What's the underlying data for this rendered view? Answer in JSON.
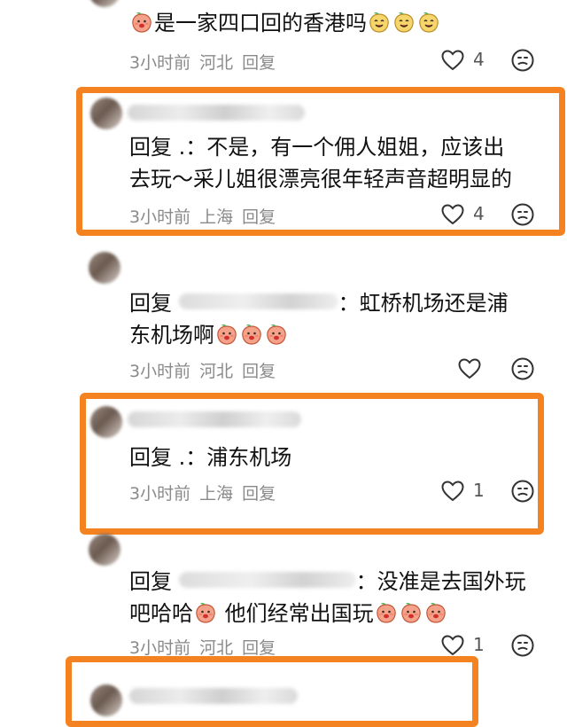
{
  "comments": [
    {
      "text": "是一家四口回的香港吗",
      "time": "3小时前",
      "location": "河北",
      "reply_label": "回复",
      "likes": "4"
    },
    {
      "reply_prefix": "回复",
      "mention": " .",
      "line1": "：不是，有一个佣人姐姐，应该出",
      "line2": "去玩～采儿姐很漂亮很年轻声音超明显的",
      "time": "3小时前",
      "location": "上海",
      "reply_label": "回复",
      "likes": "4"
    },
    {
      "reply_prefix": "回复",
      "line1": "：虹桥机场还是浦",
      "line2": "东机场啊",
      "time": "3小时前",
      "location": "河北",
      "reply_label": "回复",
      "likes": ""
    },
    {
      "reply_prefix": "回复",
      "mention": " .",
      "line1": "：浦东机场",
      "time": "3小时前",
      "location": "上海",
      "reply_label": "回复",
      "likes": "1"
    },
    {
      "reply_prefix": "回复",
      "line1": "：没准是去国外玩",
      "line2a": "吧哈哈",
      "line2b": " 他们经常出国玩",
      "time": "3小时前",
      "location": "河北",
      "reply_label": "回复",
      "likes": "1"
    }
  ],
  "colors": {
    "highlight": "#f58220",
    "meta": "#8a8a8a"
  },
  "icons": {
    "like": "heart-outline-icon",
    "dislike": "neutral-face-icon",
    "emoji": "peach-emoji-icon"
  }
}
